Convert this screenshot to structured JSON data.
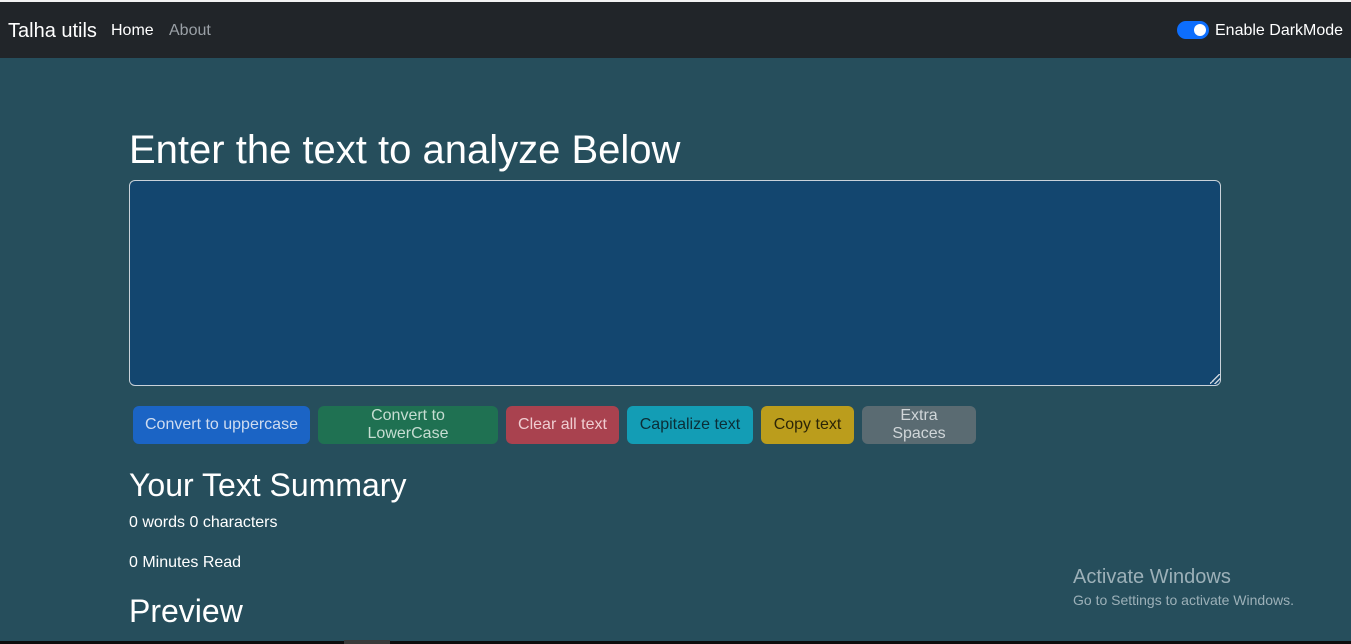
{
  "navbar": {
    "brand": "Talha utils",
    "links": [
      {
        "label": "Home",
        "active": true
      },
      {
        "label": "About",
        "active": false
      }
    ],
    "toggle": {
      "label": "Enable DarkMode",
      "checked": true
    }
  },
  "main": {
    "heading": "Enter the text to analyze Below",
    "textarea": {
      "value": "",
      "placeholder": ""
    },
    "buttons": [
      {
        "label": "Convert to uppercase",
        "color": "#1b64c5"
      },
      {
        "label": "Convert to LowerCase",
        "color": "#1f7152"
      },
      {
        "label": "Clear all text",
        "color": "#a9424f"
      },
      {
        "label": "Capitalize text",
        "color": "#139db5"
      },
      {
        "label": "Copy text",
        "color": "#bb9d1c"
      },
      {
        "label": "Extra Spaces",
        "color": "#5a6b72"
      }
    ]
  },
  "summary": {
    "title": "Your Text Summary",
    "counts": "0 words 0 characters",
    "minutes": "0 Minutes Read"
  },
  "preview": {
    "title": "Preview"
  },
  "watermark": {
    "title": "Activate Windows",
    "subtitle": "Go to Settings to activate Windows."
  },
  "colors": {
    "background": "#264e5c",
    "navbar": "#212529",
    "textarea": "#13466f",
    "toggle": "#0d6efd"
  }
}
